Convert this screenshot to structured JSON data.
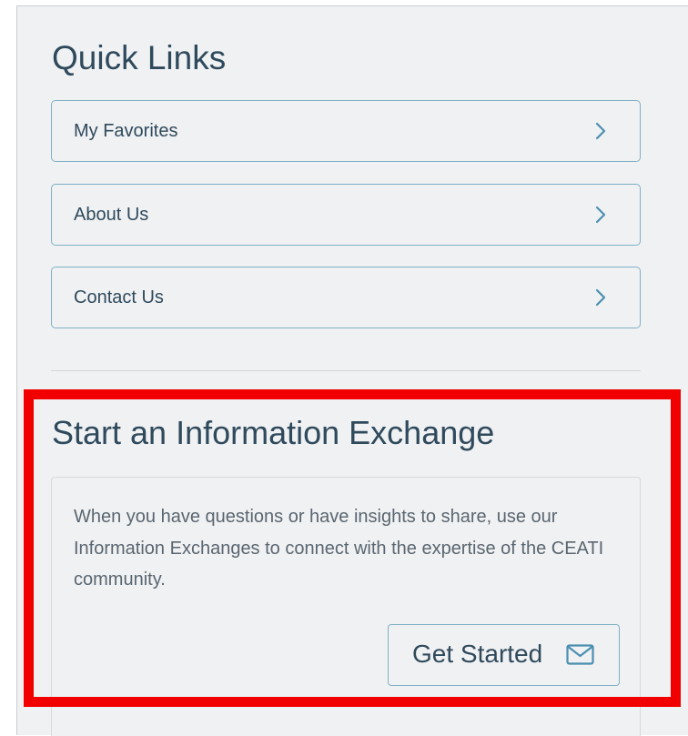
{
  "quick_links": {
    "title": "Quick Links",
    "items": [
      {
        "label": "My Favorites",
        "icon": "chevron-right-icon"
      },
      {
        "label": "About Us",
        "icon": "chevron-right-icon"
      },
      {
        "label": "Contact Us",
        "icon": "chevron-right-icon"
      }
    ]
  },
  "info_exchange": {
    "title": "Start an Information Exchange",
    "description": "When you have questions or have insights to share, use our Information Exchanges to connect with the expertise of the CEATI community.",
    "button_label": "Get Started",
    "button_icon": "mail-icon"
  },
  "colors": {
    "panel_background": "#f0f1f3",
    "heading_text": "#2f4a5c",
    "body_text": "#5a6670",
    "button_border": "#7fb0c6",
    "highlight_outline": "#f20000"
  }
}
